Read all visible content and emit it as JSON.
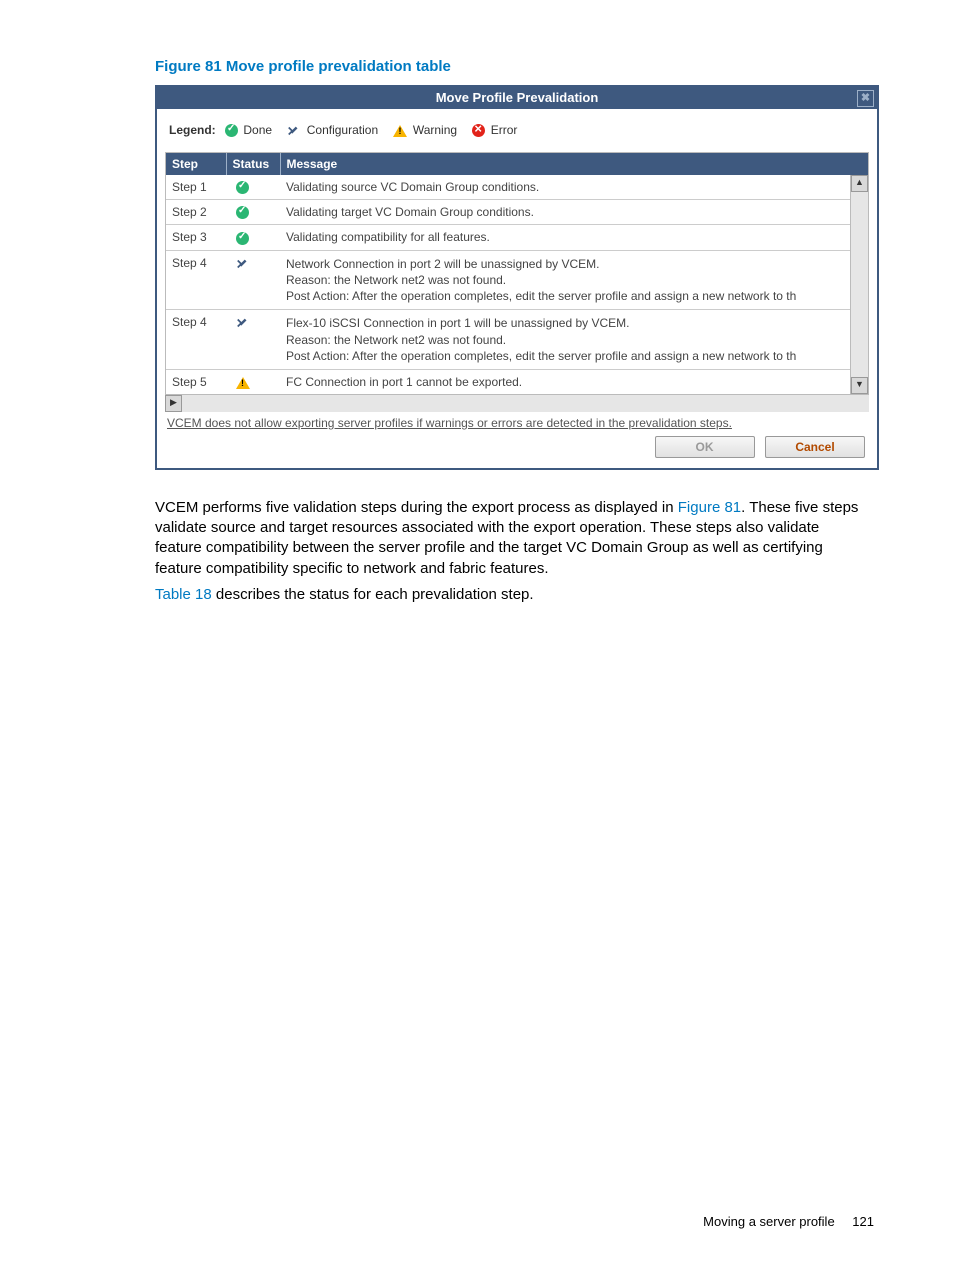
{
  "figure": {
    "caption": "Figure 81 Move profile prevalidation table"
  },
  "dialog": {
    "title": "Move Profile Prevalidation",
    "close_glyph": "✖",
    "legend": {
      "label": "Legend:",
      "items": {
        "done": "Done",
        "config": "Configuration",
        "warning": "Warning",
        "error": "Error"
      }
    },
    "columns": {
      "step": "Step",
      "status": "Status",
      "message": "Message"
    },
    "rows": [
      {
        "step": "Step 1",
        "status": "done",
        "message": "Validating source VC Domain Group conditions."
      },
      {
        "step": "Step 2",
        "status": "done",
        "message": "Validating target VC Domain Group conditions."
      },
      {
        "step": "Step 3",
        "status": "done",
        "message": "Validating compatibility for all features."
      },
      {
        "step": "Step 4",
        "status": "config",
        "message_lines": [
          "Network Connection in port 2 will be unassigned by VCEM.",
          "Reason: the Network net2 was not found.",
          "Post Action: After the operation completes, edit the server profile and assign a new network to th"
        ]
      },
      {
        "step": "Step 4",
        "status": "config",
        "message_lines": [
          "Flex-10 iSCSI Connection in port 1 will be unassigned by VCEM.",
          "Reason: the Network net2 was not found.",
          "Post Action: After the operation completes, edit the server profile and assign a new network to th"
        ]
      },
      {
        "step": "Step 5",
        "status": "warning",
        "message": "FC Connection in port 1 cannot be exported."
      }
    ],
    "note": "VCEM does not allow exporting server profiles if warnings or errors are detected in the prevalidation steps.",
    "buttons": {
      "ok": "OK",
      "cancel": "Cancel"
    }
  },
  "paragraphs": {
    "p1_a": "VCEM performs five validation steps during the export process as displayed in ",
    "p1_link": "Figure 81",
    "p1_b": ". These five steps validate source and target resources associated with the export operation. These steps also validate feature compatibility between the server profile and the target VC Domain Group as well as certifying feature compatibility specific to network and fabric features.",
    "p2_link": "Table 18",
    "p2_b": " describes the status for each prevalidation step."
  },
  "footer": {
    "section": "Moving a server profile",
    "page": "121"
  }
}
